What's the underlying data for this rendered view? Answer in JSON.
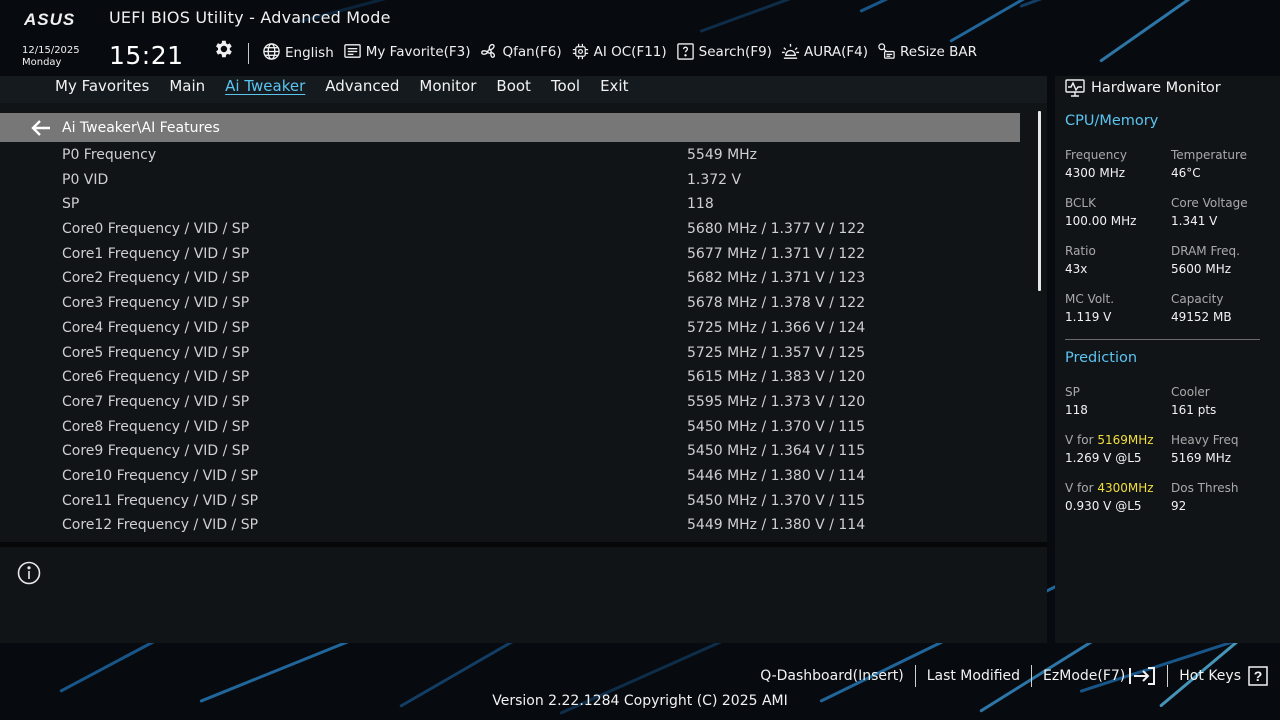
{
  "header": {
    "brand": "ASUS",
    "title": "UEFI BIOS Utility - Advanced Mode",
    "date": "12/15/2025",
    "day": "Monday",
    "time": "15:21",
    "toolbar": [
      {
        "label": "English",
        "icon": "globe-icon"
      },
      {
        "label": "My Favorite(F3)",
        "icon": "favorite-icon"
      },
      {
        "label": "Qfan(F6)",
        "icon": "fan-icon"
      },
      {
        "label": "AI OC(F11)",
        "icon": "ai-chip-icon"
      },
      {
        "label": "Search(F9)",
        "icon": "search-icon"
      },
      {
        "label": "AURA(F4)",
        "icon": "aura-icon"
      },
      {
        "label": "ReSize BAR",
        "icon": "resize-bar-icon"
      }
    ]
  },
  "nav": {
    "tabs": [
      "My Favorites",
      "Main",
      "Ai Tweaker",
      "Advanced",
      "Monitor",
      "Boot",
      "Tool",
      "Exit"
    ],
    "active": "Ai Tweaker"
  },
  "main": {
    "breadcrumb": "Ai Tweaker\\AI Features",
    "rows": [
      {
        "label": "P0 Frequency",
        "value": "5549 MHz"
      },
      {
        "label": "P0 VID",
        "value": "1.372 V"
      },
      {
        "label": "SP",
        "value": "118"
      },
      {
        "label": "Core0 Frequency / VID / SP",
        "value": "5680 MHz / 1.377 V / 122"
      },
      {
        "label": "Core1 Frequency / VID / SP",
        "value": "5677 MHz / 1.371 V / 122"
      },
      {
        "label": "Core2 Frequency / VID / SP",
        "value": "5682 MHz / 1.371 V / 123"
      },
      {
        "label": "Core3 Frequency / VID / SP",
        "value": "5678 MHz / 1.378 V / 122"
      },
      {
        "label": "Core4 Frequency / VID / SP",
        "value": "5725 MHz / 1.366 V / 124"
      },
      {
        "label": "Core5 Frequency / VID / SP",
        "value": "5725 MHz / 1.357 V / 125"
      },
      {
        "label": "Core6 Frequency / VID / SP",
        "value": "5615 MHz / 1.383 V / 120"
      },
      {
        "label": "Core7 Frequency / VID / SP",
        "value": "5595 MHz / 1.373 V / 120"
      },
      {
        "label": "Core8 Frequency / VID / SP",
        "value": "5450 MHz / 1.370 V / 115"
      },
      {
        "label": "Core9 Frequency / VID / SP",
        "value": "5450 MHz / 1.364 V / 115"
      },
      {
        "label": "Core10 Frequency / VID / SP",
        "value": "5446 MHz / 1.380 V / 114"
      },
      {
        "label": "Core11 Frequency / VID / SP",
        "value": "5450 MHz / 1.370 V / 115"
      },
      {
        "label": "Core12 Frequency / VID / SP",
        "value": "5449 MHz / 1.380 V / 114"
      }
    ]
  },
  "hw_monitor": {
    "title": "Hardware Monitor",
    "cpu_memory": {
      "title": "CPU/Memory",
      "frequency": {
        "label": "Frequency",
        "value": "4300 MHz"
      },
      "temperature": {
        "label": "Temperature",
        "value": "46°C"
      },
      "bclk": {
        "label": "BCLK",
        "value": "100.00 MHz"
      },
      "core_voltage": {
        "label": "Core Voltage",
        "value": "1.341 V"
      },
      "ratio": {
        "label": "Ratio",
        "value": "43x"
      },
      "dram_freq": {
        "label": "DRAM Freq.",
        "value": "5600 MHz"
      },
      "mc_volt": {
        "label": "MC Volt.",
        "value": "1.119 V"
      },
      "capacity": {
        "label": "Capacity",
        "value": "49152 MB"
      }
    },
    "prediction": {
      "title": "Prediction",
      "sp": {
        "label": "SP",
        "value": "118"
      },
      "cooler": {
        "label": "Cooler",
        "value": "161 pts"
      },
      "v_for_1": {
        "prefix": "V for ",
        "freq": "5169MHz",
        "value": "1.269 V @L5"
      },
      "heavy_freq": {
        "label": "Heavy Freq",
        "value": "5169 MHz"
      },
      "v_for_2": {
        "prefix": "V for ",
        "freq": "4300MHz",
        "value": "0.930 V @L5"
      },
      "dos_thresh": {
        "label": "Dos Thresh",
        "value": "92"
      }
    }
  },
  "footer": {
    "links": [
      "Q-Dashboard(Insert)",
      "Last Modified",
      "EzMode(F7)",
      "Hot Keys"
    ],
    "hotkeys_glyph": "?",
    "version": "Version 2.22.1284 Copyright (C) 2025 AMI"
  },
  "colors": {
    "accent": "#5bc4f0",
    "highlight": "#f2de3c",
    "panel": "#111417",
    "breadcrumb_bg": "#777777"
  }
}
